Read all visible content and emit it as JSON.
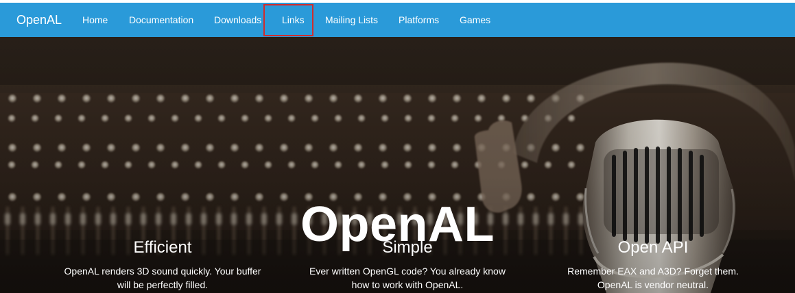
{
  "nav": {
    "brand": "OpenAL",
    "items": [
      {
        "label": "Home"
      },
      {
        "label": "Documentation"
      },
      {
        "label": "Downloads"
      },
      {
        "label": "Links"
      },
      {
        "label": "Mailing Lists"
      },
      {
        "label": "Platforms"
      },
      {
        "label": "Games"
      }
    ]
  },
  "hero": {
    "title": "OpenAL",
    "features": [
      {
        "title": "Efficient",
        "text": "OpenAL renders 3D sound quickly. Your buffer will be perfectly filled."
      },
      {
        "title": "Simple",
        "text": "Ever written OpenGL code? You already know how to work with OpenAL."
      },
      {
        "title": "Open API",
        "text": "Remember EAX and A3D? Forget them. OpenAL is vendor neutral."
      }
    ]
  },
  "colors": {
    "navbar": "#2a9ad9",
    "highlight": "#d22c2c",
    "hero_text": "#ffffff"
  }
}
